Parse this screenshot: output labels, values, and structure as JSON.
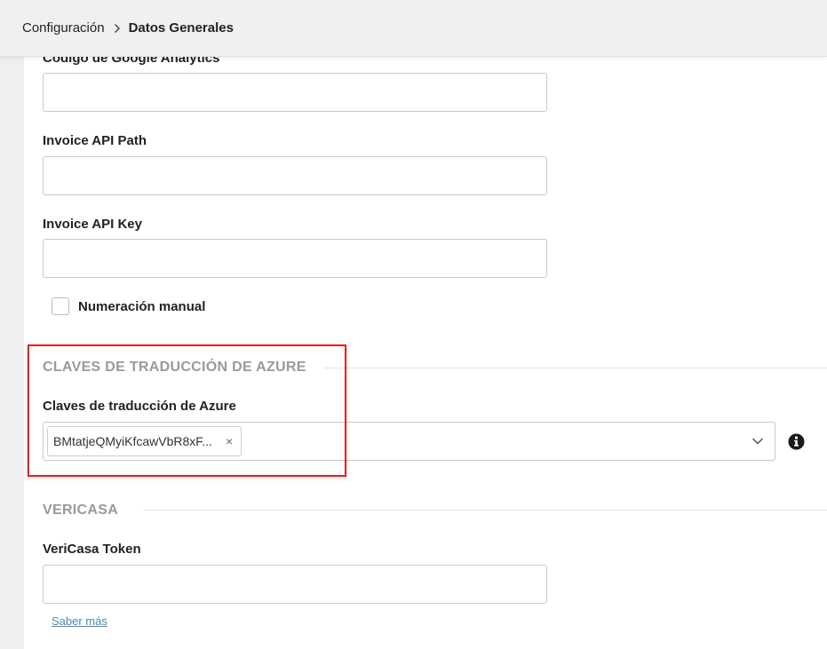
{
  "breadcrumb": {
    "parent": "Configuración",
    "current": "Datos Generales"
  },
  "form": {
    "google_analytics": {
      "label": "Código de Google Analytics",
      "value": ""
    },
    "invoice_api_path": {
      "label": "Invoice API Path",
      "value": ""
    },
    "invoice_api_key": {
      "label": "Invoice API Key",
      "value": ""
    },
    "manual_numbering": {
      "label": "Numeración manual",
      "checked": false
    }
  },
  "azure": {
    "section_title": "CLAVES DE TRADUCCIÓN DE AZURE",
    "field_label": "Claves de traducción de Azure",
    "selected_tag": "BMtatjeQMyiKfcawVbR8xF...",
    "remove_glyph": "×",
    "highlight_color": "#d42a2a"
  },
  "vericasa": {
    "section_title": "VERICASA",
    "token_label": "VeriCasa Token",
    "token_value": "",
    "learn_more": "Saber más"
  },
  "icons": {
    "breadcrumb_separator": "chevron-right-icon",
    "select_toggle": "chevron-down-icon",
    "info": "info-circle-icon"
  },
  "colors": {
    "section_title": "#9a9a9a",
    "link": "#4b8ab0",
    "topbar_bg": "#f0f0f0"
  }
}
